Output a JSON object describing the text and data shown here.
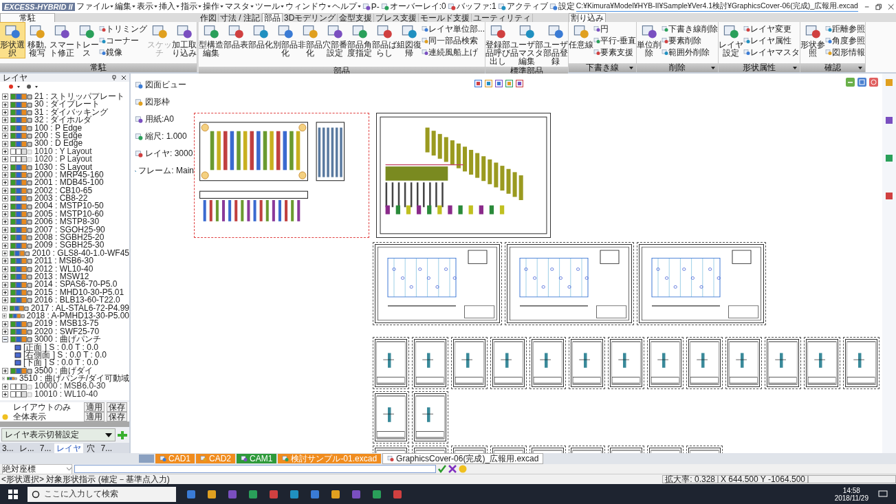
{
  "title_bar": {
    "logo": "EXCESS-HYBRID II",
    "menus": [
      "ファイル",
      "編集",
      "表示",
      "挿入",
      "指示",
      "操作",
      "マスタ",
      "ツール",
      "ウィンドウ",
      "ヘルプ"
    ],
    "quick_items": [
      "P-",
      "オーバーレイ:0",
      "バッファ:1",
      "アクティブ",
      "設定"
    ],
    "path": "C:¥Kimura¥Model¥HYB-II¥Sample¥Ver4.1検討¥GraphicsCover-06(完成)_広報用.excad"
  },
  "ribbon": {
    "resident": {
      "tab": {
        "label": "常駐",
        "selected": true
      },
      "groups": [
        {
          "label": "常駐",
          "launcher": false,
          "buttons": [
            {
              "label": "形状選択",
              "kind": "large",
              "selected": true,
              "disabled": false
            },
            {
              "label": "移動,複写",
              "kind": "large",
              "selected": false,
              "disabled": false
            },
            {
              "label": "スマート修正",
              "kind": "large",
              "selected": false,
              "disabled": false
            },
            {
              "label": "トレース",
              "kind": "large",
              "selected": false,
              "disabled": false
            },
            {
              "label": "トリミング",
              "kind": "small",
              "selected": false,
              "disabled": false
            },
            {
              "label": "コーナー",
              "kind": "small",
              "selected": false,
              "disabled": false
            },
            {
              "label": "鏡像",
              "kind": "small",
              "selected": false,
              "disabled": false
            },
            {
              "label": "スケッチ",
              "kind": "large",
              "selected": false,
              "disabled": true
            },
            {
              "label": "加工取り込み",
              "kind": "large",
              "selected": false,
              "disabled": false
            }
          ]
        }
      ]
    },
    "main": {
      "tabs": [
        {
          "label": "作図",
          "selected": false
        },
        {
          "label": "寸法 / 注記",
          "selected": false
        },
        {
          "label": "部品",
          "selected": true
        },
        {
          "label": "3Dモデリング",
          "selected": false
        },
        {
          "label": "金型支援",
          "selected": false
        },
        {
          "label": "プレス支援",
          "selected": false
        },
        {
          "label": "モールド支援",
          "selected": false
        },
        {
          "label": "ユーティリティ",
          "selected": false
        }
      ],
      "groups": [
        {
          "label": "部品",
          "launcher": false,
          "buttons": [
            {
              "label": "型構造編集",
              "kind": "large",
              "selected": false,
              "disabled": false
            },
            {
              "label": "部品表",
              "kind": "large",
              "selected": false,
              "disabled": false
            },
            {
              "label": "部品化",
              "kind": "large",
              "selected": false,
              "disabled": false
            },
            {
              "label": "別部品化",
              "kind": "large",
              "selected": false,
              "disabled": false
            },
            {
              "label": "非部品化",
              "kind": "large",
              "selected": false,
              "disabled": false
            },
            {
              "label": "穴部番設定",
              "kind": "large",
              "selected": false,
              "disabled": false
            },
            {
              "label": "部品角度指定",
              "kind": "large",
              "selected": false,
              "disabled": false
            },
            {
              "label": "部品ばらし",
              "kind": "large",
              "selected": false,
              "disabled": false
            },
            {
              "label": "組図復帰",
              "kind": "large",
              "selected": false,
              "disabled": false
            },
            {
              "label": "レイヤ単位部...",
              "kind": "small",
              "selected": false,
              "disabled": false
            },
            {
              "label": "同一部品検索",
              "kind": "small",
              "selected": false,
              "disabled": false
            },
            {
              "label": "連続風船上げ",
              "kind": "small",
              "selected": false,
              "disabled": false
            }
          ]
        },
        {
          "label": "標準部品",
          "launcher": false,
          "buttons": [
            {
              "label": "登録部品呼び出し",
              "kind": "large",
              "selected": false,
              "disabled": false
            },
            {
              "label": "ユーザ部品マスタ編集",
              "kind": "large",
              "selected": false,
              "disabled": false
            },
            {
              "label": "ユーザ部品登録",
              "kind": "large",
              "selected": false,
              "disabled": false
            }
          ]
        }
      ]
    },
    "interrupt": {
      "tab": {
        "label": "割り込み",
        "selected": true
      },
      "groups": [
        {
          "label": "下書き線",
          "launcher": true,
          "buttons": [
            {
              "label": "任意線",
              "kind": "large",
              "selected": false,
              "disabled": false
            },
            {
              "label": "円",
              "kind": "small",
              "selected": false,
              "disabled": false
            },
            {
              "label": "平行-垂直",
              "kind": "small",
              "selected": false,
              "disabled": false
            },
            {
              "label": "要素支援",
              "kind": "small",
              "selected": false,
              "disabled": false
            }
          ]
        },
        {
          "label": "削除",
          "launcher": true,
          "buttons": [
            {
              "label": "単位削除",
              "kind": "large",
              "selected": false,
              "disabled": false
            },
            {
              "label": "下書き線削除",
              "kind": "small",
              "selected": false,
              "disabled": false
            },
            {
              "label": "要素削除",
              "kind": "small",
              "selected": false,
              "disabled": false
            },
            {
              "label": "範囲外削除",
              "kind": "small",
              "selected": false,
              "disabled": false
            }
          ]
        },
        {
          "label": "形状属性",
          "launcher": true,
          "buttons": [
            {
              "label": "レイヤ設定",
              "kind": "large",
              "selected": false,
              "disabled": false
            },
            {
              "label": "レイヤ変更",
              "kind": "small",
              "selected": false,
              "disabled": false
            },
            {
              "label": "レイヤ属性",
              "kind": "small",
              "selected": false,
              "disabled": false
            },
            {
              "label": "レイヤマスタ",
              "kind": "small",
              "selected": false,
              "disabled": false
            }
          ]
        },
        {
          "label": "確認",
          "launcher": true,
          "buttons": [
            {
              "label": "形状参照",
              "kind": "large",
              "selected": false,
              "disabled": false
            },
            {
              "label": "距離参照",
              "kind": "small",
              "selected": false,
              "disabled": false
            },
            {
              "label": "角度参照",
              "kind": "small",
              "selected": false,
              "disabled": false
            },
            {
              "label": "図形情報",
              "kind": "small",
              "selected": false,
              "disabled": false
            }
          ]
        }
      ]
    }
  },
  "layer_panel": {
    "title": "レイヤ",
    "layers": [
      {
        "label": "21 : ストリッパプレート",
        "visible": true,
        "expanded": false
      },
      {
        "label": "30 : ダイプレート",
        "visible": true,
        "expanded": false
      },
      {
        "label": "31 : ダイバッキング",
        "visible": true,
        "expanded": false
      },
      {
        "label": "32 : ダイホルダ",
        "visible": true,
        "expanded": false
      },
      {
        "label": "100 : P Edge",
        "visible": true,
        "expanded": false
      },
      {
        "label": "200 : S Edge",
        "visible": true,
        "expanded": false
      },
      {
        "label": "300 : D Edge",
        "visible": true,
        "expanded": false
      },
      {
        "label": "1010 : Y Layout",
        "visible": false,
        "expanded": false
      },
      {
        "label": "1020 : P Layout",
        "visible": false,
        "expanded": false
      },
      {
        "label": "1030 : S Layout",
        "visible": true,
        "expanded": false
      },
      {
        "label": "2000 : MRP45-160",
        "visible": true,
        "expanded": false
      },
      {
        "label": "2001 : MDB45-100",
        "visible": true,
        "expanded": false
      },
      {
        "label": "2002 : CB10-65",
        "visible": true,
        "expanded": false
      },
      {
        "label": "2003 : CB8-22",
        "visible": true,
        "expanded": false
      },
      {
        "label": "2004 : MSTP10-50",
        "visible": true,
        "expanded": false
      },
      {
        "label": "2005 : MSTP10-60",
        "visible": true,
        "expanded": false
      },
      {
        "label": "2006 : MSTP8-30",
        "visible": true,
        "expanded": false
      },
      {
        "label": "2007 : SGOH25-90",
        "visible": true,
        "expanded": false
      },
      {
        "label": "2008 : SGBH25-20",
        "visible": true,
        "expanded": false
      },
      {
        "label": "2009 : SGBH25-30",
        "visible": true,
        "expanded": false
      },
      {
        "label": "2010 : GLS8-40-1.0-WF45",
        "visible": true,
        "expanded": false
      },
      {
        "label": "2011 : MSB6-30",
        "visible": true,
        "expanded": false
      },
      {
        "label": "2012 : WL10-40",
        "visible": true,
        "expanded": false
      },
      {
        "label": "2013 : MSW12",
        "visible": true,
        "expanded": false
      },
      {
        "label": "2014 : SPAS6-70-P5.0",
        "visible": true,
        "expanded": false
      },
      {
        "label": "2015 : MHD10-30-P5.01",
        "visible": true,
        "expanded": false
      },
      {
        "label": "2016 : BLB13-60-T22.0",
        "visible": true,
        "expanded": false
      },
      {
        "label": "2017 : AL-STAL6-72-P4.99",
        "visible": true,
        "expanded": false
      },
      {
        "label": "2018 : A-PMHD13-30-P5.00",
        "visible": true,
        "expanded": false
      },
      {
        "label": "2019 : MSB13-75",
        "visible": true,
        "expanded": false
      },
      {
        "label": "2020 : SWF25-70",
        "visible": true,
        "expanded": false
      },
      {
        "label": "3000 : 曲げパンチ",
        "visible": true,
        "expanded": true,
        "children": [
          {
            "label": "[正面 ] S : 0.0 T : 0.0"
          },
          {
            "label": "[右側面 ] S : 0.0 T : 0.0"
          },
          {
            "label": "[下面 ] S : 0.0 T : 0.0"
          }
        ]
      },
      {
        "label": "3500 : 曲げダイ",
        "visible": true,
        "expanded": false
      },
      {
        "label": "3510 : 曲げパンチ/ダイ可動域",
        "visible": true,
        "expanded": false
      },
      {
        "label": "10000 : MSB6.0-30",
        "visible": false,
        "expanded": false
      },
      {
        "label": "10010 : WL10-40",
        "visible": false,
        "expanded": false
      }
    ],
    "presets": [
      {
        "label": "レイアウトのみ",
        "active": false,
        "buttons": [
          "適用",
          "保存"
        ]
      },
      {
        "label": "全体表示",
        "active": true,
        "buttons": [
          "適用",
          "保存"
        ]
      }
    ],
    "switch_setting": "レイヤ表示切替設定",
    "tabs": [
      {
        "label": "3...",
        "selected": false
      },
      {
        "label": "レ...",
        "selected": false
      },
      {
        "label": "7...",
        "selected": false
      },
      {
        "label": "レイヤ",
        "selected": true
      },
      {
        "label": "穴",
        "selected": false
      },
      {
        "label": "7...",
        "selected": false
      }
    ]
  },
  "canvas": {
    "view_info": [
      "図面ビュー",
      "図形枠",
      "用紙:A0",
      "縮尺: 1.000",
      "レイヤ: 3000",
      "フレーム: Main"
    ],
    "sheet_rows": [
      [
        {
          "kind": "layout",
          "selected": true
        },
        {
          "kind": "iso",
          "selected": false
        }
      ],
      [
        {
          "kind": "plan",
          "selected": false
        },
        {
          "kind": "plan",
          "selected": false
        },
        {
          "kind": "plan",
          "selected": false
        }
      ],
      [
        {
          "kind": "part",
          "selected": false
        },
        {
          "kind": "part",
          "selected": false
        },
        {
          "kind": "part",
          "selected": false
        },
        {
          "kind": "part",
          "selected": false
        },
        {
          "kind": "part",
          "selected": false
        },
        {
          "kind": "part",
          "selected": false
        },
        {
          "kind": "part",
          "selected": false
        },
        {
          "kind": "part",
          "selected": false
        },
        {
          "kind": "part",
          "selected": false
        },
        {
          "kind": "part",
          "selected": false
        },
        {
          "kind": "part",
          "selected": false
        },
        {
          "kind": "part",
          "selected": false
        },
        {
          "kind": "part",
          "selected": false
        }
      ],
      [
        {
          "kind": "part",
          "selected": false
        },
        {
          "kind": "part",
          "selected": false
        }
      ],
      [
        {
          "kind": "part",
          "selected": false
        },
        {
          "kind": "part",
          "selected": false
        },
        {
          "kind": "part",
          "selected": false
        },
        {
          "kind": "part",
          "selected": false
        },
        {
          "kind": "part",
          "selected": false
        },
        {
          "kind": "part",
          "selected": false
        },
        {
          "kind": "part",
          "selected": false
        },
        {
          "kind": "part",
          "selected": false
        },
        {
          "kind": "part",
          "selected": false
        }
      ]
    ]
  },
  "document_tabs": [
    {
      "label": "CAD1",
      "color": "#f08c1e",
      "selected": false
    },
    {
      "label": "CAD2",
      "color": "#f08c1e",
      "selected": false
    },
    {
      "label": "CAM1",
      "color": "#2e9a3a",
      "selected": false
    },
    {
      "label": "検討サンプル-01.excad",
      "color": "#f08c1e",
      "selected": false
    },
    {
      "label": "GraphicsCover-06(完成)_広報用.excad",
      "color": "#ffffff",
      "selected": true
    }
  ],
  "command_bar": {
    "coordinate_mode": "絶対座標"
  },
  "status_bar": {
    "message": "<形状選択> 対象形状指示 (確定－基準点入力)",
    "zoom": "拡大率: 0.328",
    "coords": "X 644.500 Y -1064.500"
  },
  "taskbar": {
    "search_placeholder": "ここに入力して検索",
    "time": "14:58",
    "date": "2018/11/29"
  }
}
